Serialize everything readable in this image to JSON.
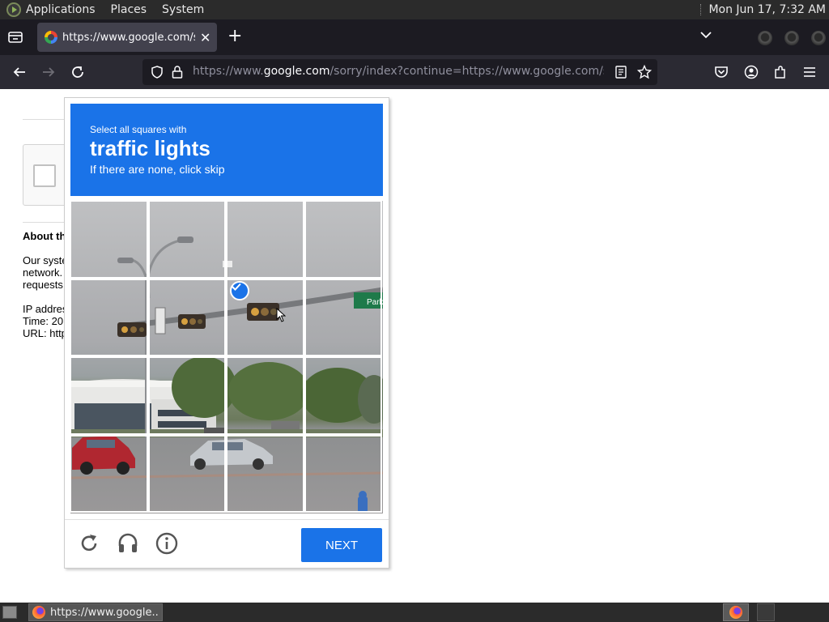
{
  "top_panel": {
    "menus": [
      "Applications",
      "Places",
      "System"
    ],
    "clock": "Mon Jun 17,  7:32 AM"
  },
  "browser": {
    "tab": {
      "title": "https://www.google.com/sorry/index"
    },
    "url": {
      "prefix": "https://www.",
      "domain": "google.com",
      "path": "/sorry/index?continue=https://www.google.com/search%"
    }
  },
  "page": {
    "about_heading": "About this page",
    "para_lines": [
      "Our systems have detected unusual traffic from your computer",
      "network.",
      "requests"
    ],
    "ip_line": "IP address:",
    "time_line": "Time: 20",
    "url_line": "URL: http"
  },
  "captcha": {
    "instruction": "Select all squares with",
    "target": "traffic lights",
    "hint": "If there are none, click skip",
    "grid": {
      "rows": 4,
      "cols": 4,
      "selected": [
        [
          1,
          2
        ]
      ]
    },
    "sign_text": "Park",
    "next_label": "NEXT",
    "accent_color": "#1a73e8"
  },
  "taskbar": {
    "task_title": "https://www.google..."
  }
}
